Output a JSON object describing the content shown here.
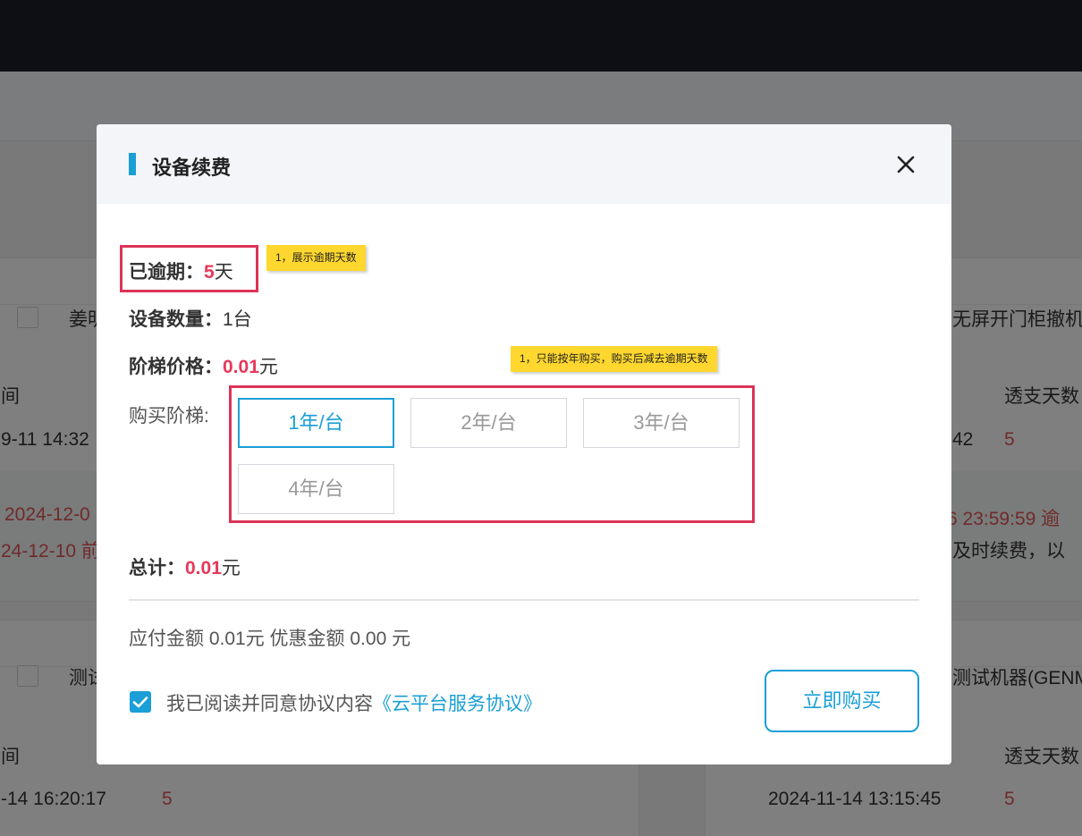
{
  "background": {
    "rows": [
      {
        "name": "姜明",
        "time_label": "间",
        "datetime": "9-11 14:32",
        "expire_date": "2024-12-0",
        "expire_date2": "24-12-10 前"
      },
      {
        "name": "测试",
        "time_label": "间",
        "datetime": "-14 16:20:17",
        "overdraft": "5"
      }
    ],
    "right_rows": [
      {
        "name": "无屏开门柜撤机",
        "overdraft_label": "透支天数",
        "datetime": "42",
        "overdraft": "5",
        "expire_text": "6 23:59:59  逾",
        "renew_text": "及时续费，以"
      },
      {
        "name": "测试机器(GENM",
        "overdraft_label": "透支天数",
        "datetime": "2024-11-14 13:15:45",
        "overdraft": "5"
      }
    ]
  },
  "modal": {
    "title": "设备续费",
    "overdue": {
      "label": "已逾期：",
      "value": "5",
      "unit": "天"
    },
    "device_count": {
      "label": "设备数量：",
      "value": "1台"
    },
    "tier_price": {
      "label": "阶梯价格：",
      "value": "0.01",
      "unit": "元"
    },
    "tier_label": "购买阶梯:",
    "tiers": [
      {
        "label": "1年/台",
        "selected": true
      },
      {
        "label": "2年/台",
        "selected": false
      },
      {
        "label": "3年/台",
        "selected": false
      },
      {
        "label": "4年/台",
        "selected": false
      }
    ],
    "total": {
      "label": "总计：",
      "value": "0.01",
      "unit": "元"
    },
    "payment_line": "应付金额 0.01元 优惠金额 0.00 元",
    "agreement": {
      "checked": true,
      "text": "我已阅读并同意协议内容",
      "link": "《云平台服务协议》"
    },
    "buy_button": "立即购买"
  },
  "annotations": {
    "overdue_note": "1，展示逾期天数",
    "tier_note": "1，只能按年购买，购买后减去逾期天数"
  },
  "colors": {
    "accent": "#1a9fd6",
    "highlight": "#e8385a",
    "annotation_border": "#dc3457",
    "note_bg": "#ffd72e"
  }
}
